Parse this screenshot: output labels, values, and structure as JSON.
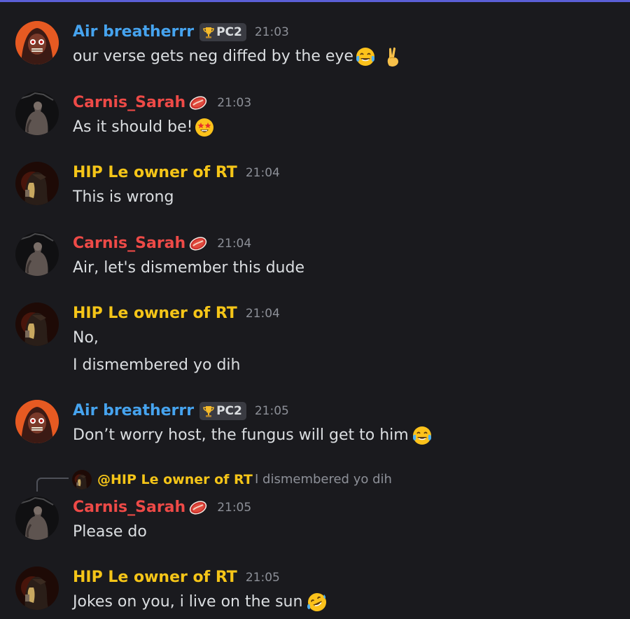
{
  "accent_color": "#5b5fd6",
  "messages": [
    {
      "author": "Air breatherrr",
      "tag": "PC2",
      "time": "21:03",
      "lines": [
        "our verse gets neg diffed by the eye"
      ],
      "emojis": [
        "joy-emoji",
        "victory-hand-emoji"
      ]
    },
    {
      "author": "Carnis_Sarah",
      "time": "21:03",
      "lines": [
        "As it should be!"
      ],
      "emojis": [
        "star-struck-emoji"
      ]
    },
    {
      "author": "HIP Le owner of RT",
      "time": "21:04",
      "lines": [
        "This is wrong"
      ]
    },
    {
      "author": "Carnis_Sarah",
      "time": "21:04",
      "lines": [
        "Air, let's dismember this dude"
      ]
    },
    {
      "author": "HIP Le owner of RT",
      "time": "21:04",
      "lines": [
        "No,",
        "I dismembered yo dih"
      ]
    },
    {
      "author": "Air breatherrr",
      "tag": "PC2",
      "time": "21:05",
      "lines": [
        "Don’t worry host, the fungus will get to him"
      ],
      "emojis": [
        "joy-emoji"
      ]
    },
    {
      "author": "Carnis_Sarah",
      "time": "21:05",
      "lines": [
        "Please do"
      ],
      "reply": {
        "mention": "@HIP Le owner of RT",
        "quoted_text": "I dismembered yo dih"
      }
    },
    {
      "author": "HIP Le owner of RT",
      "time": "21:05",
      "lines": [
        "Jokes on you, i live on the sun"
      ],
      "emojis": [
        "rofl-emoji"
      ]
    }
  ],
  "author_colors": {
    "Air breatherrr": "#46a3ee",
    "Carnis_Sarah": "#ee4a47",
    "HIP Le owner of RT": "#f5c518"
  }
}
